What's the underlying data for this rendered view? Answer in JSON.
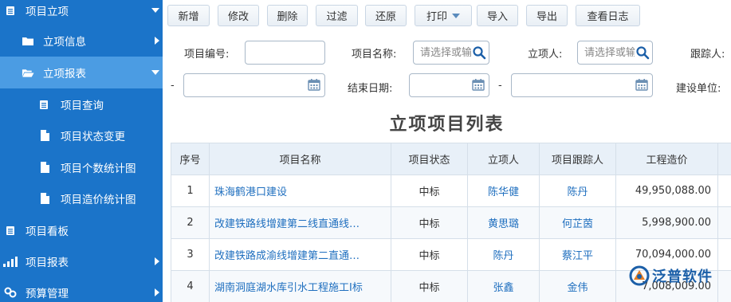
{
  "sidebar": {
    "items": [
      {
        "label": "项目立项",
        "icon": "document-icon"
      },
      {
        "label": "立项信息",
        "icon": "folder-icon"
      },
      {
        "label": "立项报表",
        "icon": "folder-open-icon"
      },
      {
        "label": "项目查询",
        "icon": "document-icon"
      },
      {
        "label": "项目状态变更",
        "icon": "file-icon"
      },
      {
        "label": "项目个数统计图",
        "icon": "file-icon"
      },
      {
        "label": "项目造价统计图",
        "icon": "file-icon"
      },
      {
        "label": "项目看板",
        "icon": "document-icon"
      },
      {
        "label": "项目报表",
        "icon": "bar-chart-icon"
      },
      {
        "label": "预算管理",
        "icon": "link-icon"
      }
    ],
    "colors": {
      "background": "#1b74c9",
      "active": "#4b9ce3"
    }
  },
  "toolbar": {
    "add": "新增",
    "edit": "修改",
    "delete": "删除",
    "filter": "过滤",
    "restore": "还原",
    "print": "打印",
    "import": "导入",
    "export": "导出",
    "view_log": "查看日志"
  },
  "filters": {
    "project_no_label": "项目编号:",
    "project_name_label": "项目名称:",
    "project_name_placeholder": "请选择或输入",
    "initiator_label": "立项人:",
    "initiator_placeholder": "请选择或输入",
    "tracker_label": "跟踪人:",
    "dash1": "-",
    "end_date_label": "结束日期:",
    "dash2": "-",
    "construction_unit_label": "建设单位:"
  },
  "list": {
    "title": "立项项目列表",
    "headers": [
      "序号",
      "项目名称",
      "项目状态",
      "立项人",
      "项目跟踪人",
      "工程造价"
    ],
    "rows": [
      {
        "no": "1",
        "name": "珠海鹤港口建设",
        "status": "中标",
        "initiator": "陈华健",
        "tracker": "陈丹",
        "cost": "49,950,088.00"
      },
      {
        "no": "2",
        "name": "改建铁路线增建第二线直通线…",
        "status": "中标",
        "initiator": "黄思璐",
        "tracker": "何芷茵",
        "cost": "5,998,900.00"
      },
      {
        "no": "3",
        "name": "改建铁路成渝线增建第二直通…",
        "status": "中标",
        "initiator": "陈丹",
        "tracker": "蔡江平",
        "cost": "70,094,000.00"
      },
      {
        "no": "4",
        "name": "湖南洞庭湖水库引水工程施工I标",
        "status": "中标",
        "initiator": "张鑫",
        "tracker": "金伟",
        "cost": "7,008,009.00"
      }
    ],
    "colors": {
      "header_bg": "#e8f0f8",
      "link": "#1f6fbf"
    }
  },
  "logo": {
    "text": "泛普软件"
  }
}
